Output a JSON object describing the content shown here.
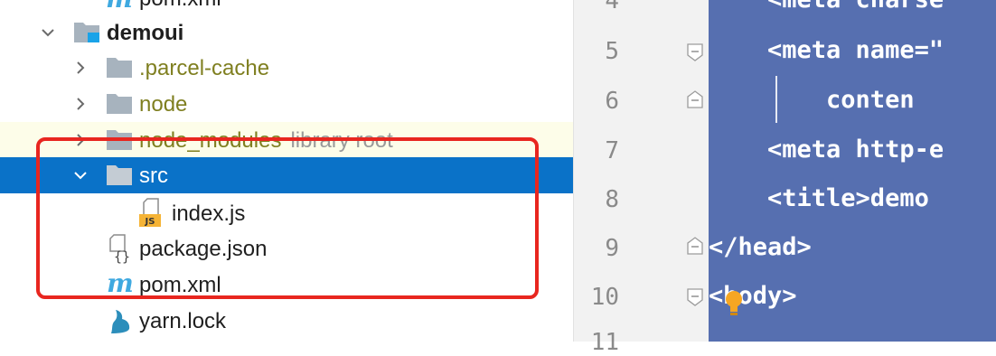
{
  "tree": {
    "top_partial_label": "pom.xml",
    "items": [
      {
        "label": "demoui"
      },
      {
        "label": ".parcel-cache"
      },
      {
        "label": "node"
      },
      {
        "label": "node_modules",
        "hint": "library root"
      },
      {
        "label": "src"
      },
      {
        "label": "index.js"
      },
      {
        "label": "package.json"
      },
      {
        "label": "pom.xml"
      },
      {
        "label": "yarn.lock"
      }
    ]
  },
  "editor": {
    "line_numbers": [
      "4",
      "5",
      "6",
      "7",
      "8",
      "9",
      "10",
      "11"
    ],
    "lines": [
      "    <meta charse",
      "    <meta name=\"",
      "        conten",
      "    <meta http-e",
      "    <title>demo ",
      "</head>",
      "<body>",
      ""
    ]
  },
  "colors": {
    "selection": "#0a72c8",
    "code_selection": "#566fb0",
    "highlight_box": "#e8261f",
    "excluded_folder_text": "#7f7f20"
  }
}
